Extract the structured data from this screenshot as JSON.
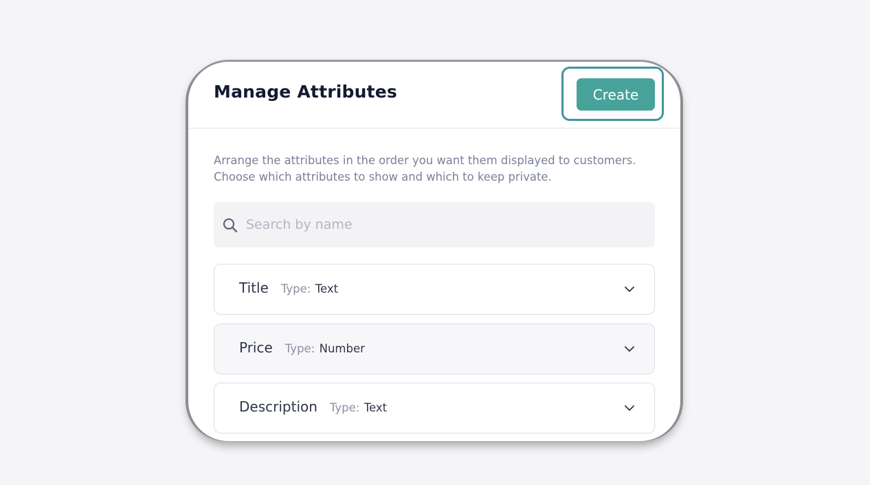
{
  "dialog": {
    "title": "Manage Attributes",
    "create_label": "Create",
    "description_line1": "Arrange the attributes in the order you want them displayed to customers.",
    "description_line2": "Choose which attributes to show and which to keep private."
  },
  "search": {
    "placeholder": "Search by name",
    "value": "",
    "icon": "search-icon"
  },
  "attributes": [
    {
      "name": "Title",
      "type_label": "Type:",
      "type_value": "Text"
    },
    {
      "name": "Price",
      "type_label": "Type:",
      "type_value": "Number"
    },
    {
      "name": "Description",
      "type_label": "Type:",
      "type_value": "Text"
    }
  ],
  "colors": {
    "accent": "#47a39a",
    "focus_ring": "#3f959a",
    "title": "#141a33",
    "muted_text": "#7a7f99",
    "background": "#f5f5f9"
  }
}
